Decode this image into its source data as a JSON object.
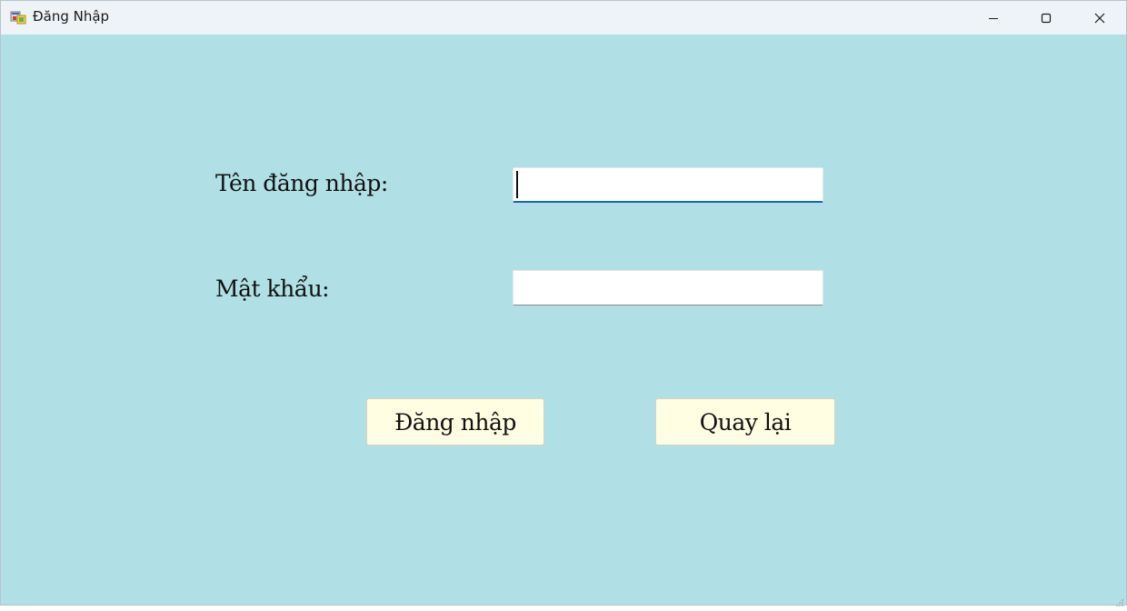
{
  "window": {
    "title": "Đăng Nhập",
    "icons": {
      "app": "app-form-icon",
      "minimize": "minimize-icon",
      "maximize": "maximize-icon",
      "close": "close-icon"
    }
  },
  "form": {
    "username_label": "Tên đăng nhập:",
    "username_value": "",
    "password_label": "Mật khẩu:",
    "password_value": "",
    "login_button": "Đăng nhập",
    "back_button": "Quay lại"
  },
  "colors": {
    "background": "#b0dfe5",
    "button_background": "#fffde2",
    "focus_accent": "#1565c0"
  }
}
